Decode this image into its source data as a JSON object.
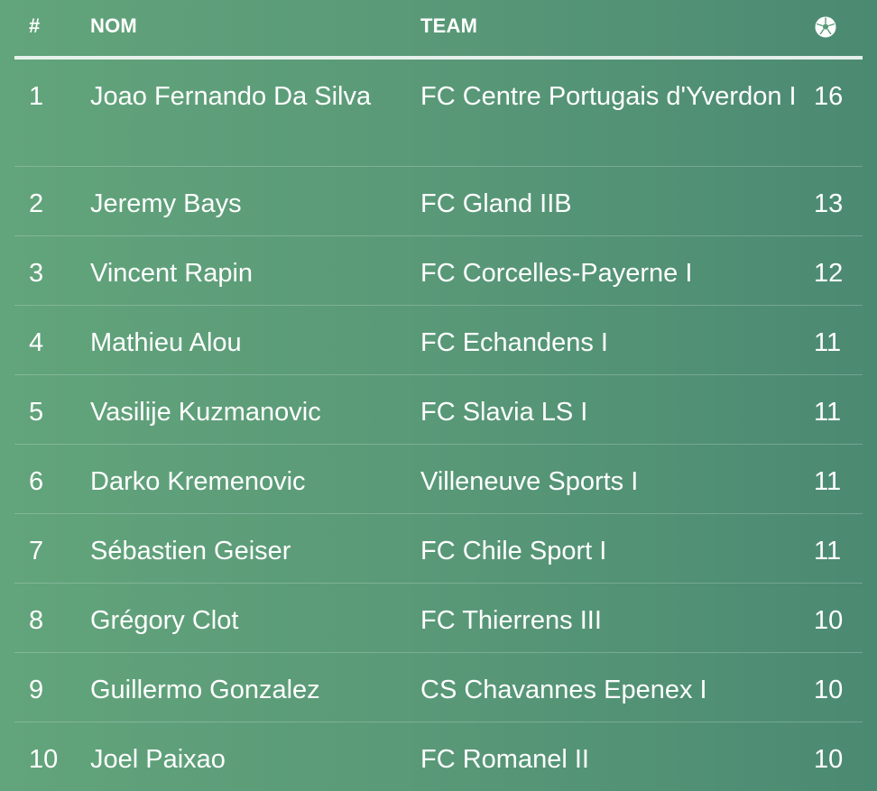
{
  "header": {
    "rank_label": "#",
    "name_label": "NOM",
    "team_label": "TEAM",
    "goals_icon": "soccer-ball-icon"
  },
  "rows": [
    {
      "rank": "1",
      "name": "Joao Fernando Da Silva",
      "team": "FC Centre Portugais d'Yverdon I",
      "goals": "16"
    },
    {
      "rank": "2",
      "name": "Jeremy Bays",
      "team": "FC Gland IIB",
      "goals": "13"
    },
    {
      "rank": "3",
      "name": "Vincent Rapin",
      "team": "FC Corcelles-Payerne I",
      "goals": "12"
    },
    {
      "rank": "4",
      "name": "Mathieu Alou",
      "team": "FC Echandens I",
      "goals": "11"
    },
    {
      "rank": "5",
      "name": "Vasilije Kuzmanovic",
      "team": "FC Slavia LS I",
      "goals": "11"
    },
    {
      "rank": "6",
      "name": "Darko Kremenovic",
      "team": "Villeneuve Sports I",
      "goals": "11"
    },
    {
      "rank": "7",
      "name": "Sébastien Geiser",
      "team": "FC Chile Sport I",
      "goals": "11"
    },
    {
      "rank": "8",
      "name": "Grégory Clot",
      "team": "FC Thierrens III",
      "goals": "10"
    },
    {
      "rank": "9",
      "name": "Guillermo Gonzalez",
      "team": "CS Chavannes Epenex I",
      "goals": "10"
    },
    {
      "rank": "10",
      "name": "Joel Paixao",
      "team": "FC Romanel II",
      "goals": "10"
    }
  ]
}
